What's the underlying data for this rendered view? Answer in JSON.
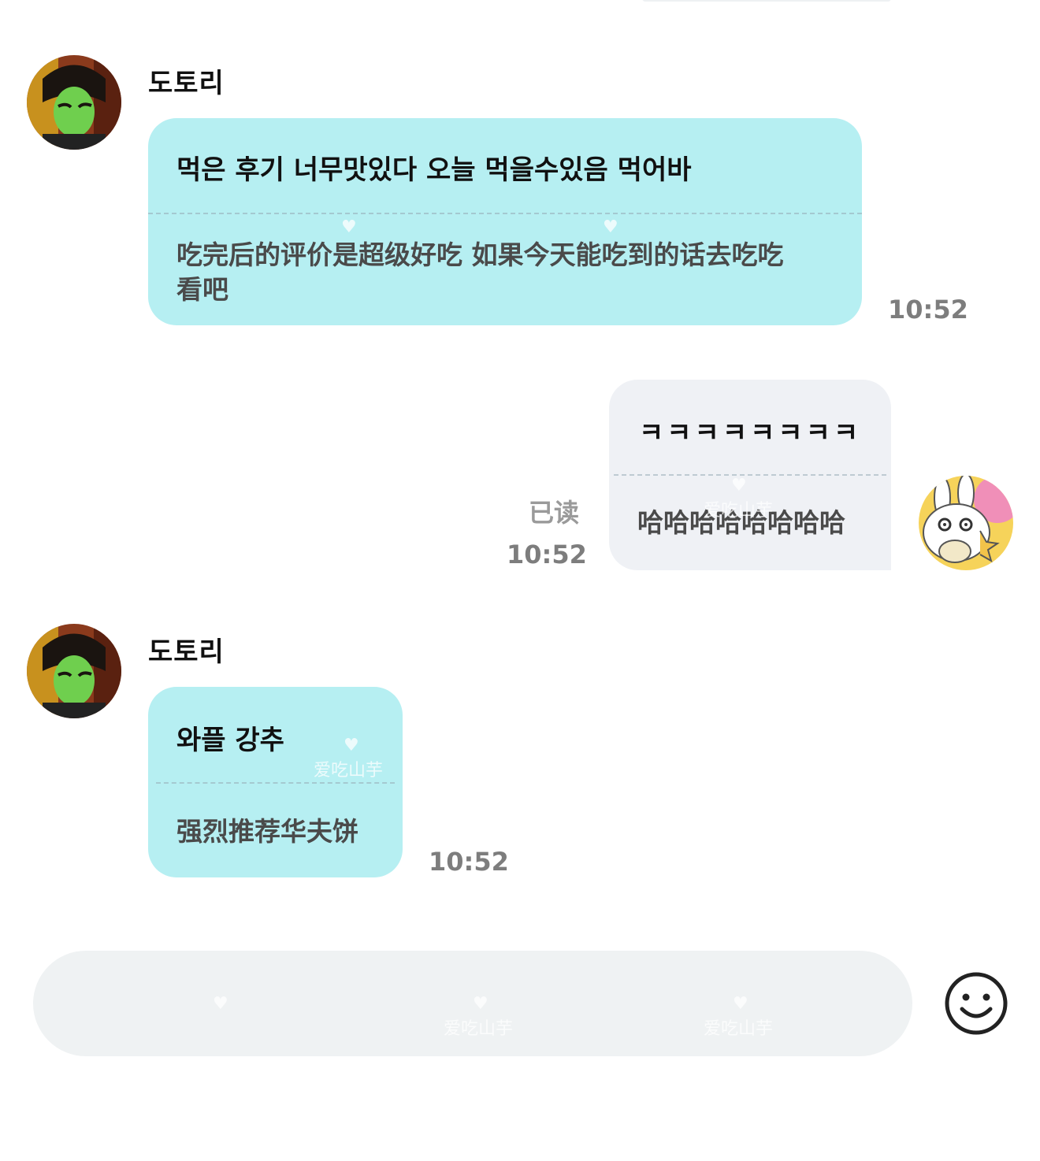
{
  "chat": {
    "messages": [
      {
        "direction": "incoming",
        "sender": "도토리",
        "text_ko": "먹은 후기 너무맛있다 오늘 먹을수있음 먹어바",
        "text_zh_lines": [
          "吃完后的评价是超级好吃 如果今天能吃到的话去吃吃",
          "看吧"
        ],
        "time": "10:52",
        "avatar_icon": "profile-photo"
      },
      {
        "direction": "outgoing",
        "text_ko": "ㅋㅋㅋㅋㅋㅋㅋㅋ",
        "text_zh_lines": [
          "哈哈哈哈哈哈哈哈"
        ],
        "read_status": "已读",
        "time": "10:52",
        "avatar_icon": "bunny-sticker-avatar"
      },
      {
        "direction": "incoming",
        "sender": "도토리",
        "text_ko": "와플 강추",
        "text_zh_lines": [
          "强烈推荐华夫饼"
        ],
        "time": "10:52",
        "avatar_icon": "profile-photo"
      }
    ]
  },
  "input_bar": {
    "emoji_icon": "smiley-face-icon"
  },
  "watermark": {
    "text": "爱吃山芋",
    "icon": "heart-icon"
  },
  "colors": {
    "incoming_bubble": "#b6eff2",
    "outgoing_bubble": "#eff1f5",
    "input_bar": "#eff2f3",
    "time_text": "#7d7d7d",
    "translation_text": "#4a4a4a"
  }
}
